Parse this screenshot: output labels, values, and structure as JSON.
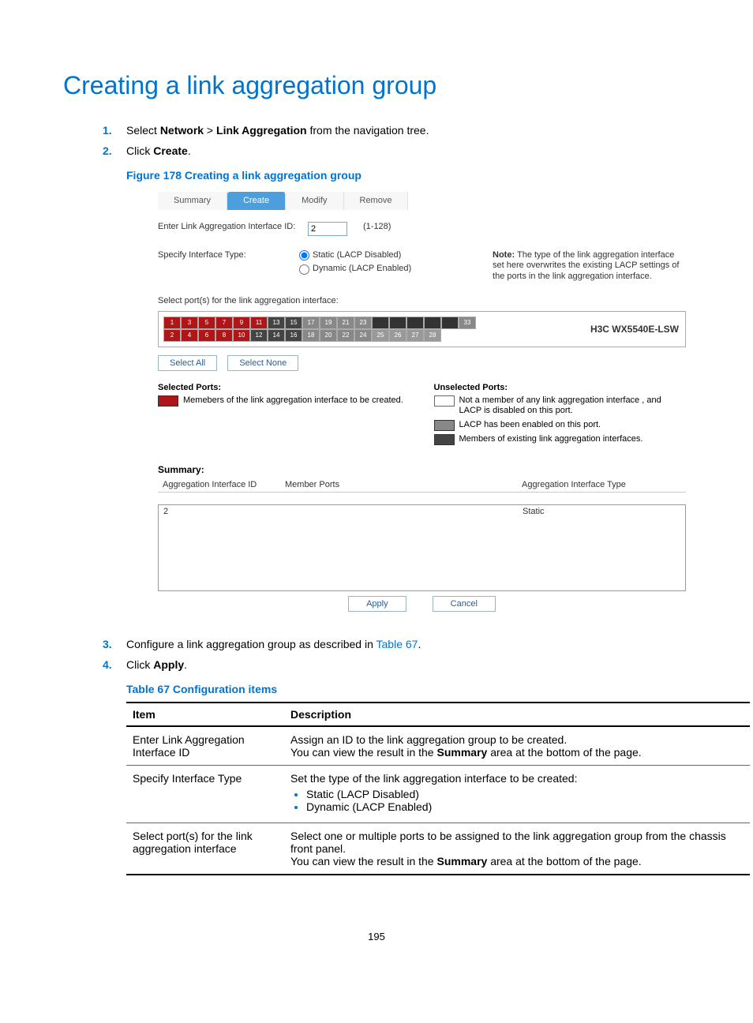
{
  "title": "Creating a link aggregation group",
  "steps": [
    {
      "num": "1.",
      "html_parts": [
        "Select ",
        "Network",
        " > ",
        "Link Aggregation",
        " from the navigation tree."
      ]
    },
    {
      "num": "2.",
      "html_parts": [
        "Click ",
        "Create",
        "."
      ]
    }
  ],
  "figure_caption": "Figure 178 Creating a link aggregation group",
  "screen": {
    "tabs": [
      "Summary",
      "Create",
      "Modify",
      "Remove"
    ],
    "active_tab": "Create",
    "interface_id_label": "Enter Link Aggregation Interface ID:",
    "interface_id_value": "2",
    "interface_id_range": "(1-128)",
    "iface_type_label": "Specify Interface Type:",
    "radio_static": "Static (LACP Disabled)",
    "radio_dynamic": "Dynamic (LACP Enabled)",
    "iface_note_bold": "Note:",
    "iface_note_rest": " The type of the link aggregation interface set here overwrites the existing LACP settings of the ports in the link aggregation interface.",
    "select_ports_label": "Select port(s) for the link aggregation interface:",
    "device_model": "H3C WX5540E-LSW",
    "top_row_ports": [
      "1",
      "3",
      "5",
      "7",
      "9",
      "11",
      "13",
      "15",
      "17",
      "19",
      "21",
      "23",
      "",
      "",
      "",
      "",
      "",
      "33"
    ],
    "bottom_row_ports": [
      "2",
      "4",
      "6",
      "8",
      "10",
      "12",
      "14",
      "16",
      "18",
      "20",
      "22",
      "24",
      "25",
      "26",
      "27",
      "28"
    ],
    "selected_port_nums": [
      "1",
      "3",
      "5",
      "7",
      "9",
      "11",
      "2",
      "4",
      "6",
      "8",
      "10"
    ],
    "select_all": "Select All",
    "select_none": "Select None",
    "selected_hdr": "Selected Ports:",
    "unselected_hdr": "Unselected Ports:",
    "selected_legend": "Memebers of the link aggregation interface to be created.",
    "un1": "Not a member of any link aggregation interface , and LACP is disabled on this port.",
    "un2": "LACP has been enabled on this port.",
    "un3": "Members of existing link aggregation interfaces.",
    "summary_title": "Summary:",
    "col1": "Aggregation Interface ID",
    "col2": "Member Ports",
    "col3": "Aggregation Interface Type",
    "row_id": "2",
    "row_ports": "",
    "row_type": "Static",
    "apply": "Apply",
    "cancel": "Cancel"
  },
  "steps_after": [
    {
      "num": "3.",
      "text_before": "Configure a link aggregation group as described in ",
      "link": "Table 67",
      "text_after": "."
    },
    {
      "num": "4.",
      "text_before": "Click ",
      "bold": "Apply",
      "text_after": "."
    }
  ],
  "table_caption": "Table 67 Configuration items",
  "table": {
    "head_item": "Item",
    "head_desc": "Description",
    "rows": [
      {
        "item": "Enter Link Aggregation Interface ID",
        "desc_lines": [
          "Assign an ID to the link aggregation group to be created.",
          {
            "pre": "You can view the result in the ",
            "bold": "Summary",
            "post": " area at the bottom of the page."
          }
        ]
      },
      {
        "item": "Specify Interface Type",
        "desc_intro": "Set the type of the link aggregation interface to be created:",
        "bullets": [
          "Static (LACP Disabled)",
          "Dynamic (LACP Enabled)"
        ]
      },
      {
        "item": "Select port(s) for the link aggregation interface",
        "desc_lines": [
          "Select one or multiple ports to be assigned to the link aggregation group from the chassis front panel.",
          {
            "pre": "You can view the result in the ",
            "bold": "Summary",
            "post": " area at the bottom of the page."
          }
        ]
      }
    ]
  },
  "page_number": "195"
}
